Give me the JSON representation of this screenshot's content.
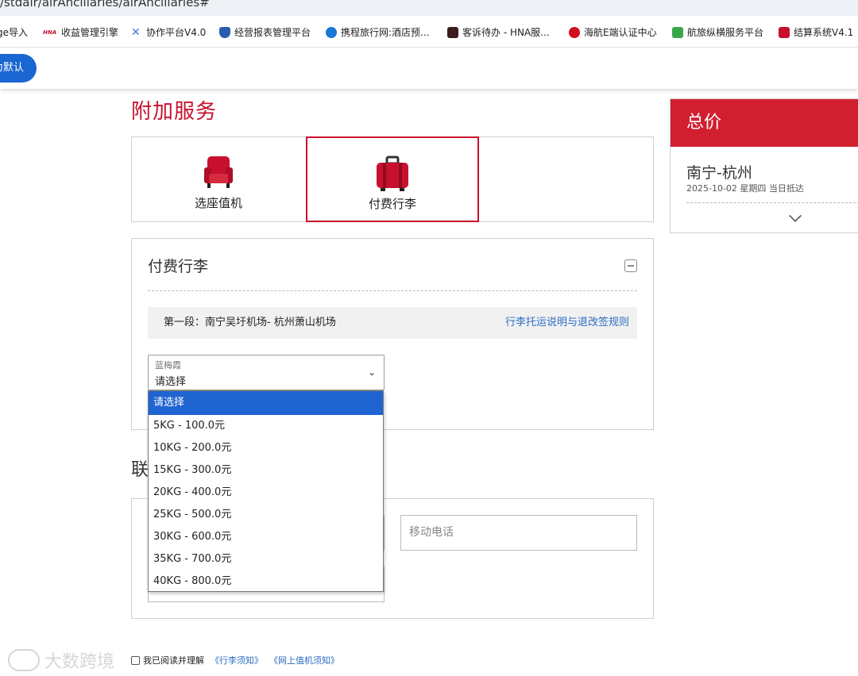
{
  "browser": {
    "url_fragment": "/stdair/airAncillaries/airAncillaries#",
    "bookmarks": [
      {
        "label": "ge导入",
        "color": "#ffffff"
      },
      {
        "label": "收益管理引擎",
        "color": "#c8102e"
      },
      {
        "label": "协作平台V4.0",
        "color": "#3a7bd5"
      },
      {
        "label": "经营报表管理平台",
        "color": "#2a5db0"
      },
      {
        "label": "携程旅行网:酒店预...",
        "color": "#1b77d3"
      },
      {
        "label": "客诉待办 - HNA服...",
        "color": "#c8102e"
      },
      {
        "label": "海航E端认证中心",
        "color": "#d0101e"
      },
      {
        "label": "航旅纵横服务平台",
        "color": "#3aa64b"
      },
      {
        "label": "结算系统V4.1",
        "color": "#c8102e"
      }
    ],
    "default_button": "为默认"
  },
  "page": {
    "title": "附加服务",
    "tabs": [
      {
        "label": "选座值机",
        "icon": "seat-icon"
      },
      {
        "label": "付费行李",
        "icon": "luggage-icon"
      }
    ],
    "baggage": {
      "title": "付费行李",
      "segment_text": "第一段：南宁吴圩机场- 杭州萧山机场",
      "rules_link": "行李托运说明与退改签规则",
      "passenger_name": "蓝梅霞",
      "selected_value": "请选择",
      "options": [
        "请选择",
        "5KG - 100.0元",
        "10KG - 200.0元",
        "15KG - 300.0元",
        "20KG - 400.0元",
        "25KG - 500.0元",
        "30KG - 600.0元",
        "35KG - 700.0元",
        "40KG - 800.0元"
      ]
    },
    "contact": {
      "section_title": "联",
      "phone_placeholder": "移动电话"
    },
    "agreement": {
      "text": "我已阅读并理解",
      "link1": "《行李须知》",
      "link2": "《网上值机须知》"
    },
    "watermark": "大数跨境"
  },
  "summary": {
    "header": "总价",
    "route": "南宁-杭州",
    "date": "2025-10-02 星期四 当日抵达"
  },
  "colors": {
    "brand_red": "#c8102e",
    "header_red": "#d21f2f",
    "link_blue": "#2b6cc4",
    "select_blue": "#1f64d1"
  }
}
